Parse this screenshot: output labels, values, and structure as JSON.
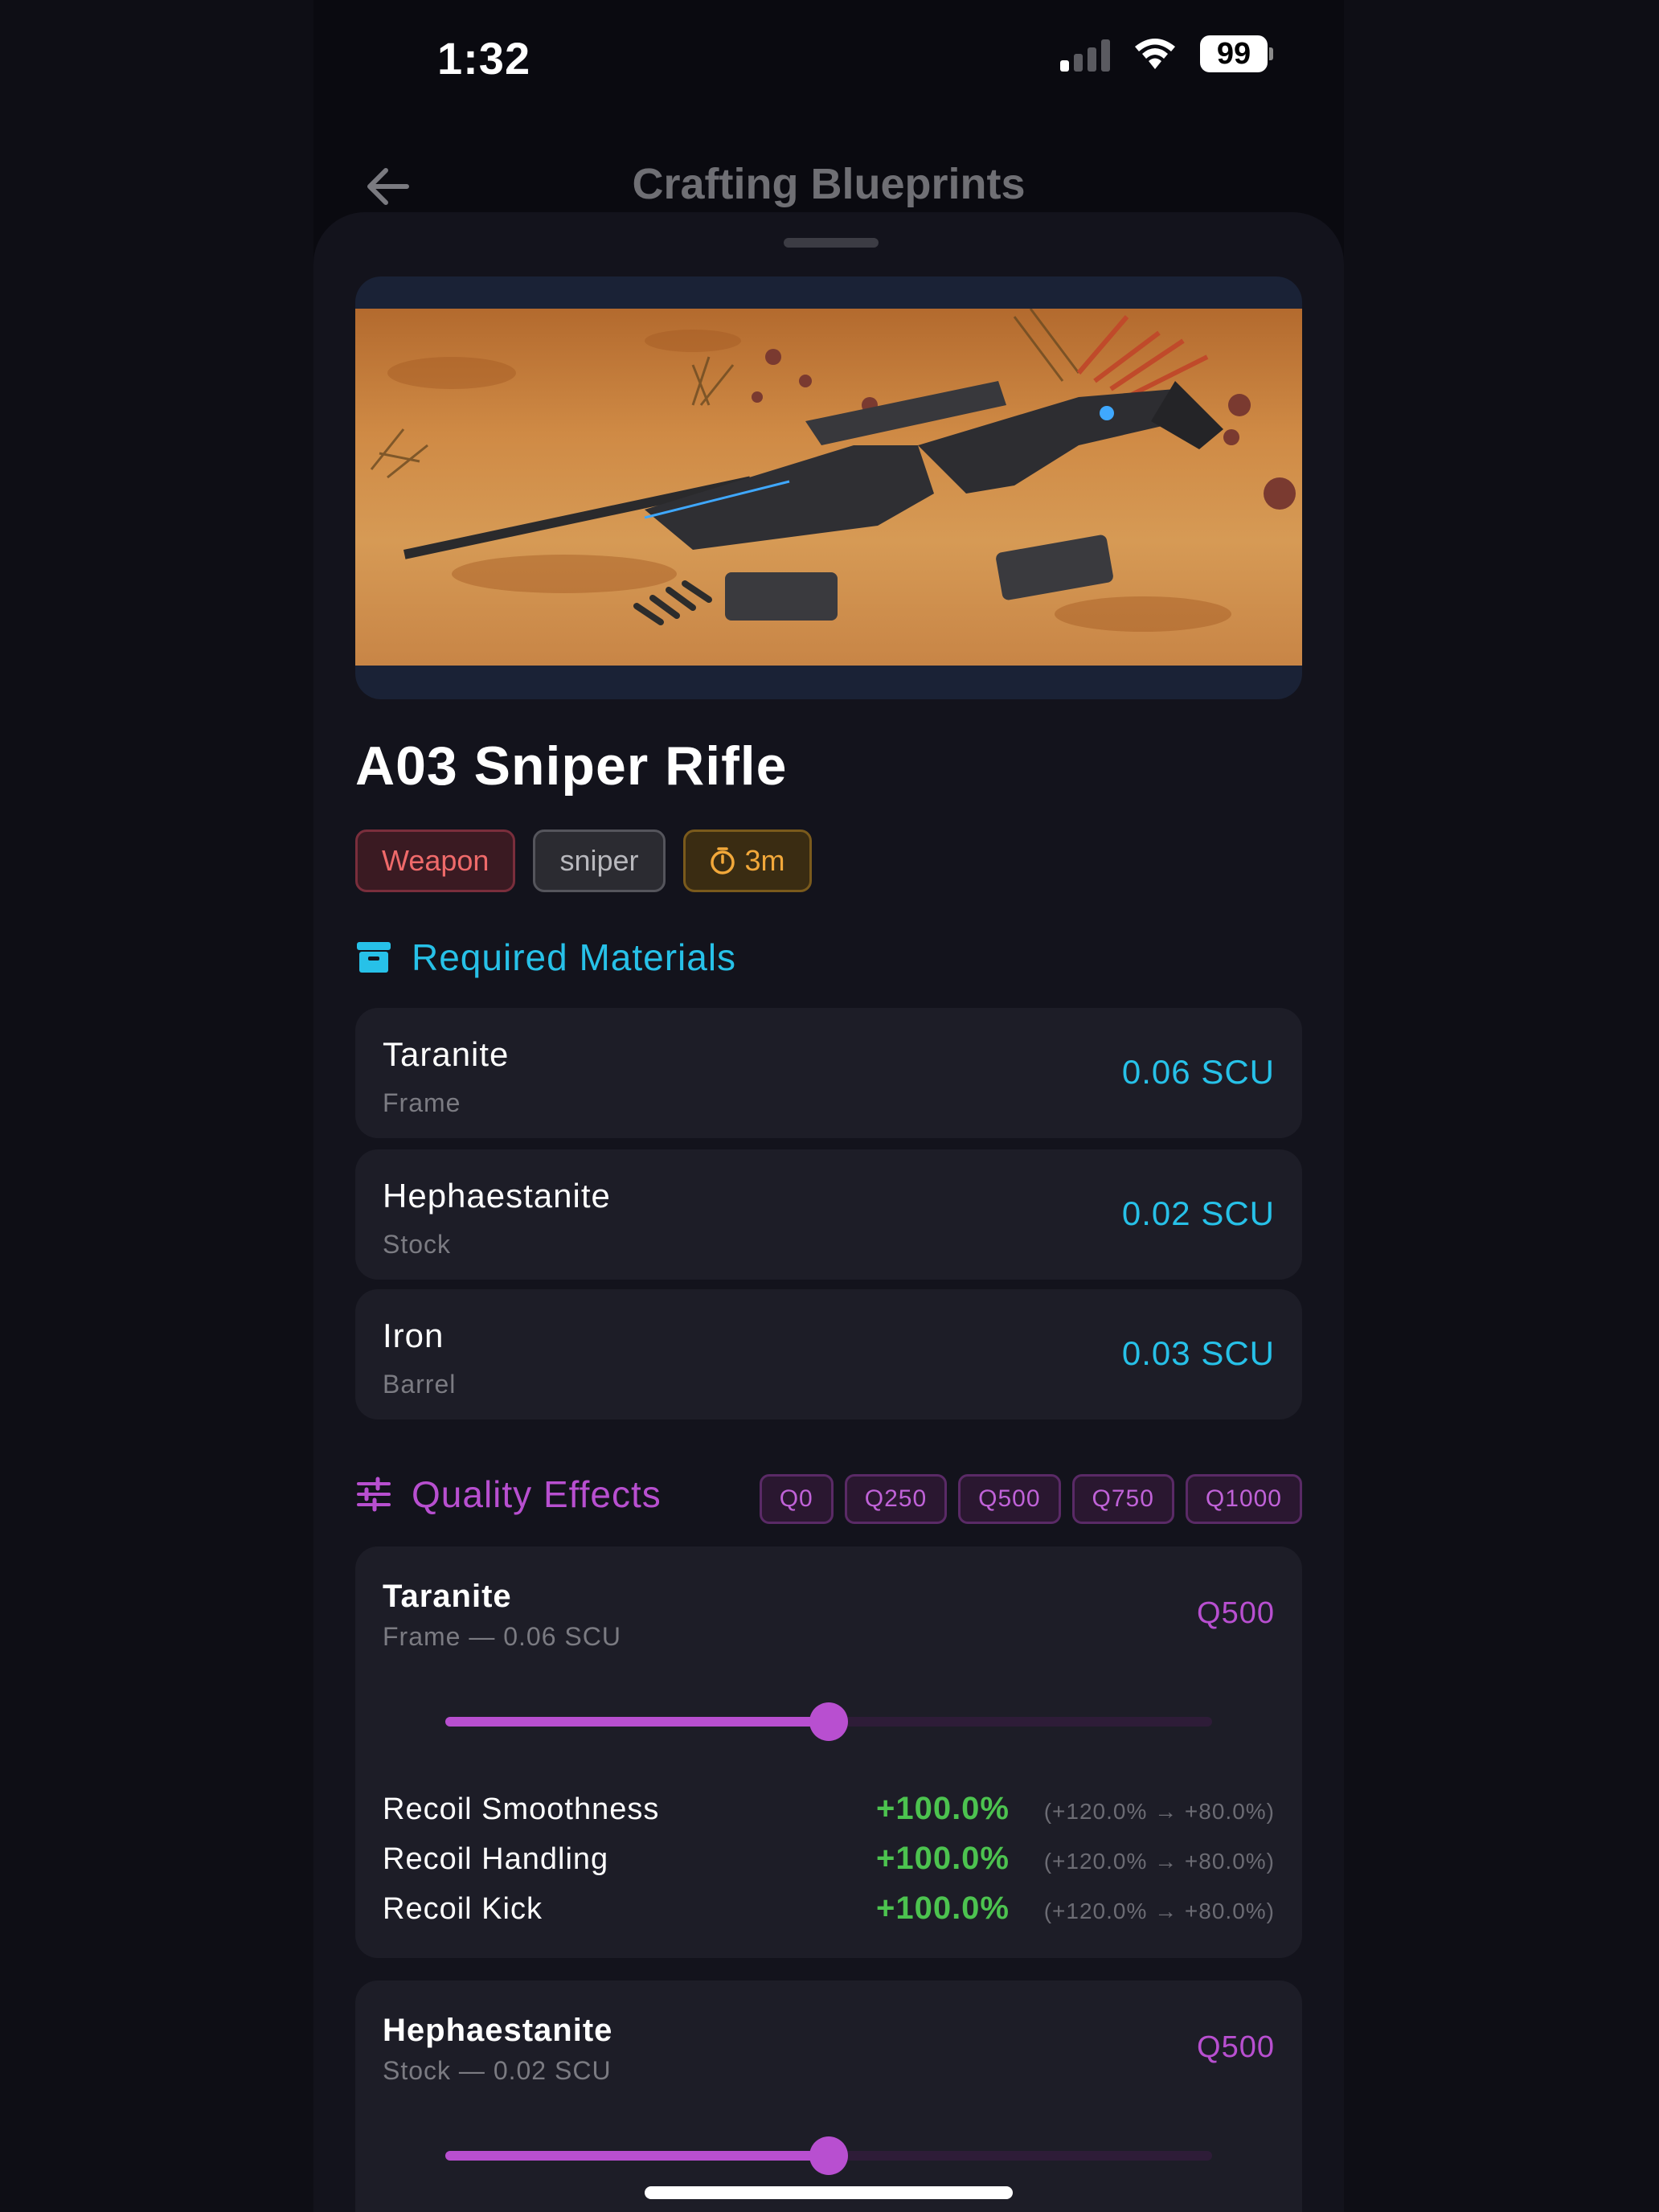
{
  "status_bar": {
    "time": "1:32",
    "battery": "99"
  },
  "nav": {
    "title": "Crafting Blueprints"
  },
  "item": {
    "title": "A03 Sniper Rifle",
    "tags": {
      "category": "Weapon",
      "type": "sniper",
      "time": "3m"
    }
  },
  "required_materials": {
    "heading": "Required Materials",
    "items": [
      {
        "name": "Taranite",
        "part": "Frame",
        "amount": "0.06 SCU"
      },
      {
        "name": "Hephaestanite",
        "part": "Stock",
        "amount": "0.02 SCU"
      },
      {
        "name": "Iron",
        "part": "Barrel",
        "amount": "0.03 SCU"
      }
    ]
  },
  "quality_effects": {
    "heading": "Quality Effects",
    "presets": [
      "Q0",
      "Q250",
      "Q500",
      "Q750",
      "Q1000"
    ],
    "cards": [
      {
        "name": "Taranite",
        "sub": "Frame — 0.06 SCU",
        "level": "Q500",
        "slider_value": 0.5,
        "effects": [
          {
            "name": "Recoil Smoothness",
            "value": "+100.0%",
            "range": "(+120.0% → +80.0%)"
          },
          {
            "name": "Recoil Handling",
            "value": "+100.0%",
            "range": "(+120.0% → +80.0%)"
          },
          {
            "name": "Recoil Kick",
            "value": "+100.0%",
            "range": "(+120.0% → +80.0%)"
          }
        ]
      },
      {
        "name": "Hephaestanite",
        "sub": "Stock — 0.02 SCU",
        "level": "Q500",
        "slider_value": 0.5
      }
    ]
  },
  "colors": {
    "accent_cyan": "#27c1e8",
    "accent_purple": "#b84fd0",
    "positive_green": "#4cc34f",
    "weapon_red": "#ef6a6a",
    "timer_orange": "#f2a83a"
  },
  "icons": [
    "back-arrow-icon",
    "archive-box-icon",
    "sliders-icon",
    "stopwatch-icon",
    "cellular-signal-icon",
    "wifi-icon",
    "battery-icon"
  ]
}
